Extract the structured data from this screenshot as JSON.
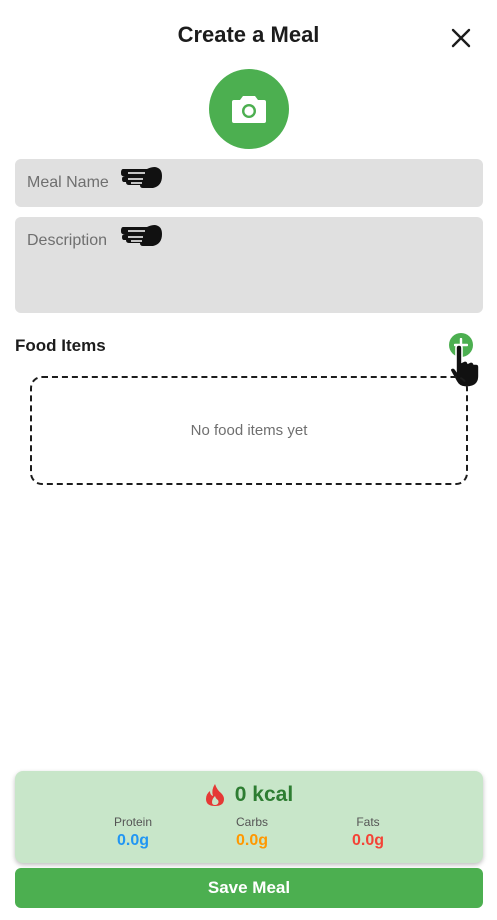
{
  "header": {
    "title": "Create a Meal",
    "close_icon": "close-icon"
  },
  "photo": {
    "icon": "camera-icon",
    "background_color": "#4caf50"
  },
  "form": {
    "meal_name_placeholder": "Meal Name",
    "description_placeholder": "Description",
    "field_background": "#e0e0e0"
  },
  "food_items": {
    "label": "Food Items",
    "add_icon": "plus-icon",
    "empty_text": "No food items yet"
  },
  "summary": {
    "calories_icon": "flame-icon",
    "calories": "0 kcal",
    "background": "#c8e6c9",
    "macros": [
      {
        "label": "Protein",
        "value": "0.0g",
        "color": "#2196f3"
      },
      {
        "label": "Carbs",
        "value": "0.0g",
        "color": "#ff9800"
      },
      {
        "label": "Fats",
        "value": "0.0g",
        "color": "#f44336"
      }
    ]
  },
  "footer": {
    "save_label": "Save Meal",
    "accent": "#4caf50"
  }
}
